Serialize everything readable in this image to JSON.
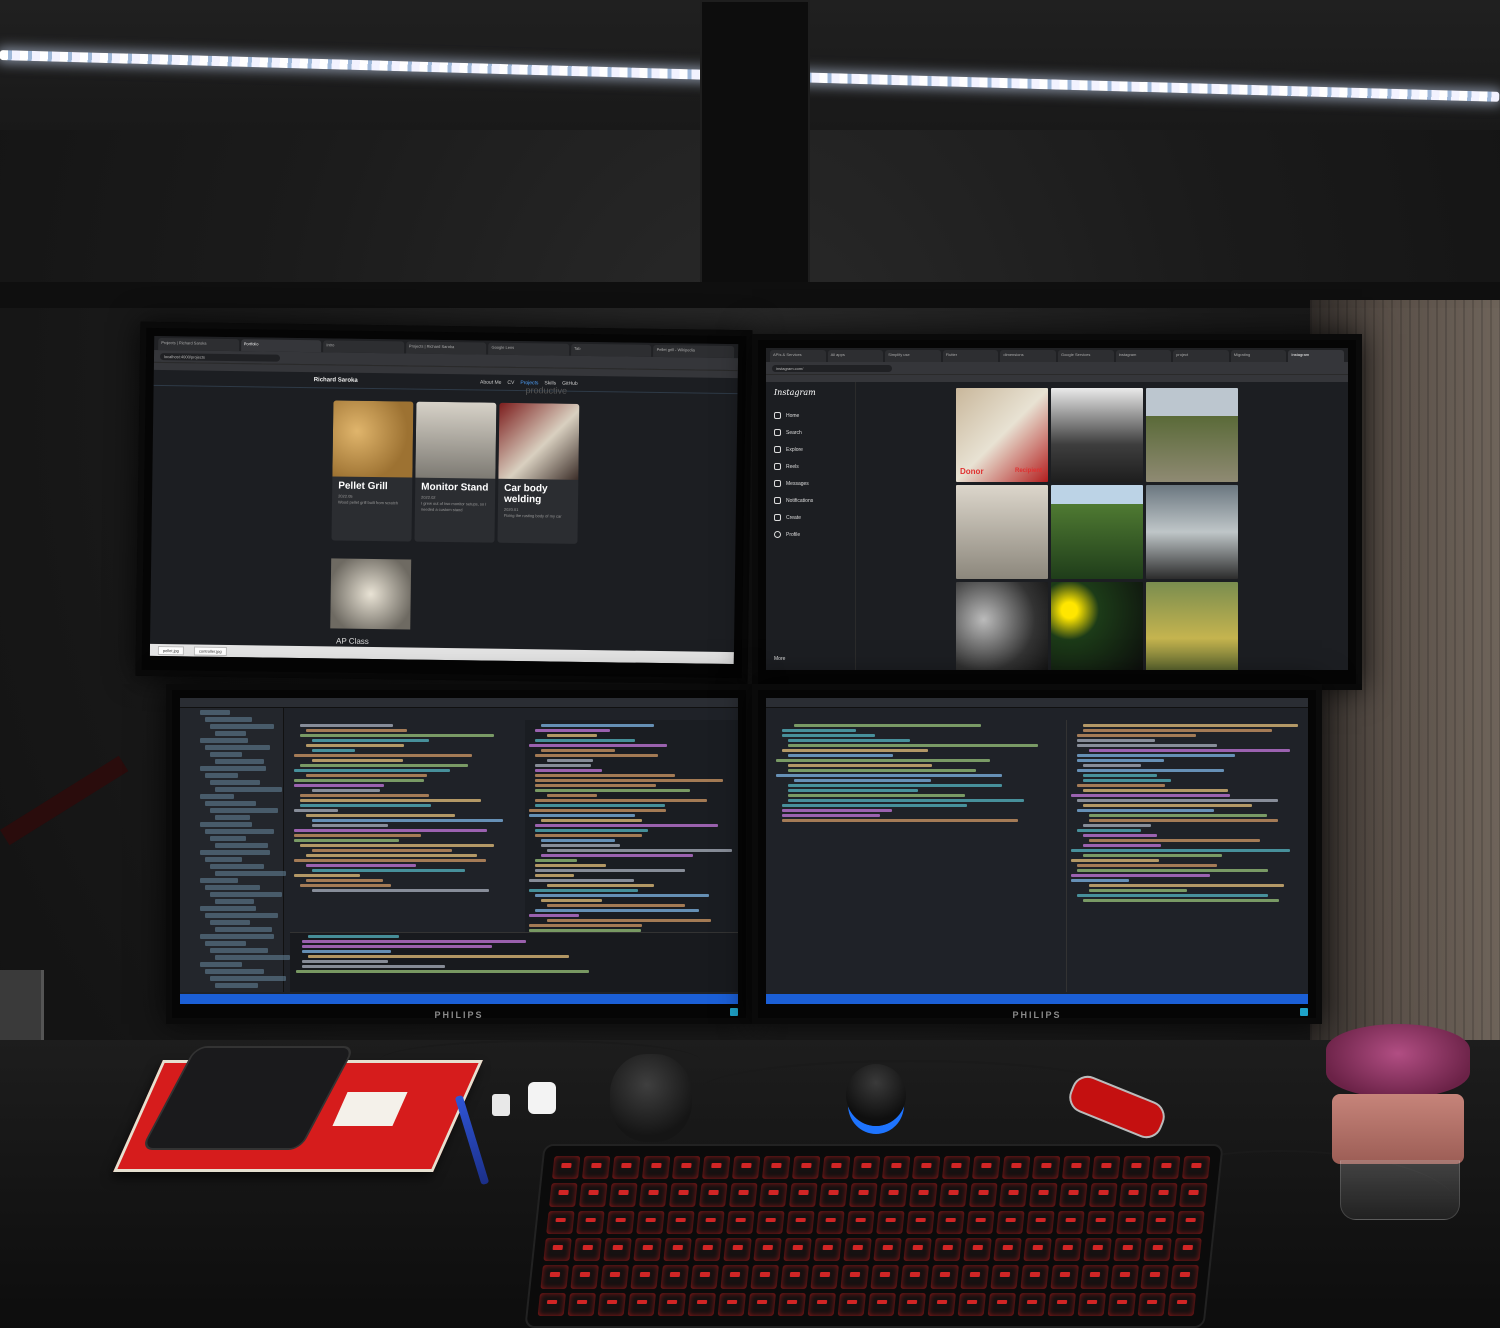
{
  "scene": "desk-setup-photo",
  "monitors": {
    "top_left": {
      "brand": "",
      "browser": {
        "tabs": [
          "Projects | Richard Saroka",
          "Portfolio",
          "Intro",
          "Projects | Richard Saroka",
          "Google Lens",
          "Tab",
          "Pellet grill - Wikipedia"
        ],
        "address": "localhost:4000/projects"
      },
      "site": {
        "brand": "Richard Saroka",
        "nav": [
          "About Me",
          "CV",
          "Projects",
          "Skills",
          "GitHub"
        ],
        "active_nav": "Projects",
        "watermark": "productive",
        "cards": [
          {
            "title": "Pellet Grill",
            "date": "2022.05",
            "desc": "Wood pellet grill built from scratch"
          },
          {
            "title": "Monitor Stand",
            "date": "2022.02",
            "desc": "I grew out of two monitor setups, so I needed a custom stand"
          },
          {
            "title": "Car body welding",
            "date": "2020.01",
            "desc": "Fixing the rusting body of my car"
          }
        ],
        "partial_card_title": "AP Class"
      },
      "downloads": [
        "pellet.jpg",
        "controller.jpg"
      ]
    },
    "top_right": {
      "brand": "",
      "browser": {
        "tabs": [
          "APIs & Services",
          "All apps",
          "Simplify use",
          "Flutter",
          "dimensions",
          "Google Services",
          "Instagram",
          "project",
          "Migrating",
          "Instagram"
        ],
        "address": "instagram.com/"
      },
      "instagram": {
        "logo": "Instagram",
        "menu": [
          "Home",
          "Search",
          "Explore",
          "Reels",
          "Messages",
          "Notifications",
          "Create",
          "Profile"
        ],
        "more": "More",
        "post_caption_1": "Donor",
        "post_caption_2": "Recipient"
      }
    },
    "bottom_left": {
      "brand": "PHILIPS"
    },
    "bottom_right": {
      "brand": "PHILIPS"
    }
  },
  "colors": {
    "led": "#f2f4ff",
    "keyboard_backlight": "#ff2a2a",
    "ide_status": "#1b5fd6",
    "notebook": "#d61c1c",
    "knob_ring": "#1e74ff"
  }
}
